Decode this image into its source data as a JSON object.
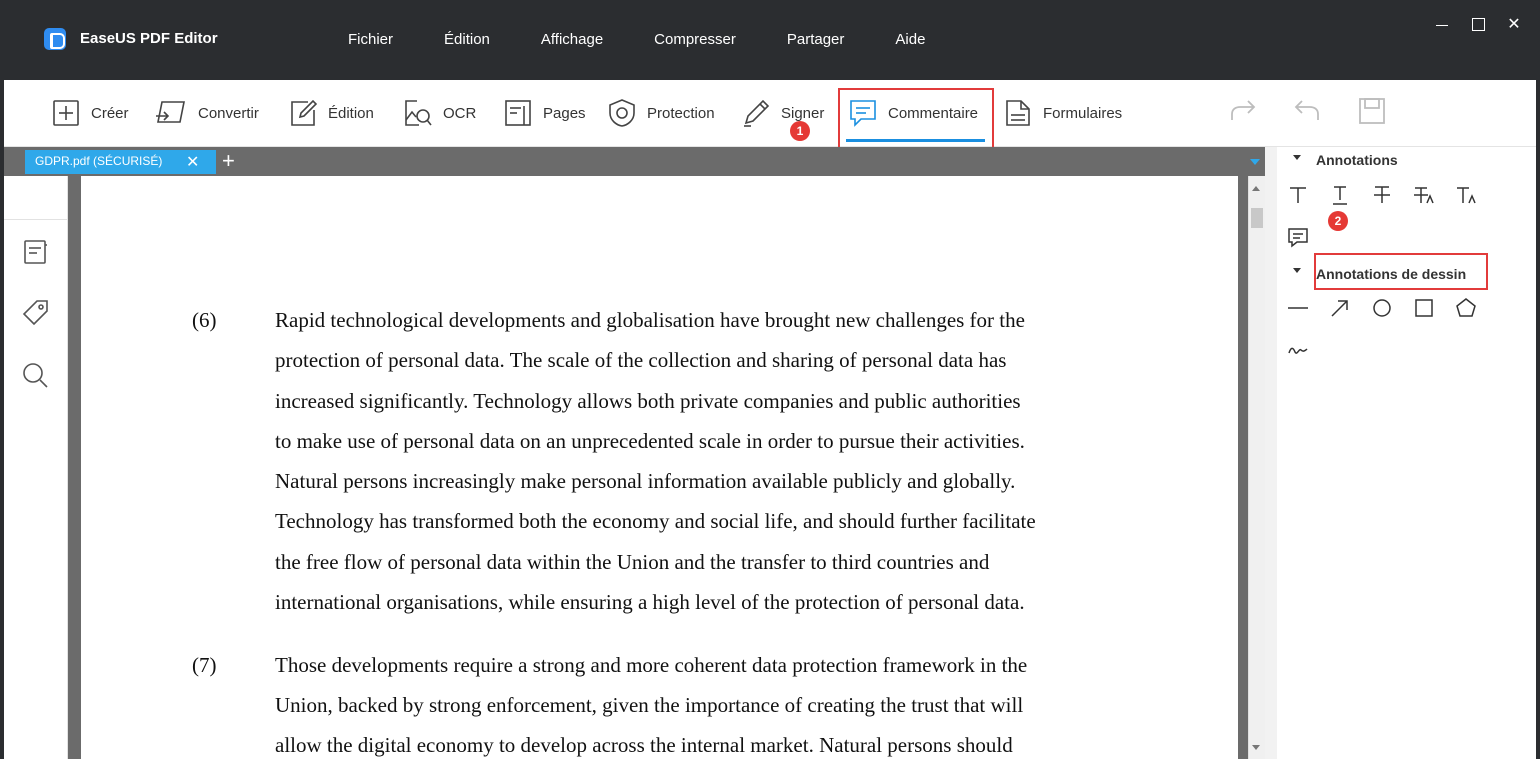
{
  "app": {
    "name": "EaseUS PDF Editor"
  },
  "menu": [
    "Fichier",
    "Édition",
    "Affichage",
    "Compresser",
    "Partager",
    "Aide"
  ],
  "toolbar": {
    "creer": "Créer",
    "convertir": "Convertir",
    "edition": "Édition",
    "ocr": "OCR",
    "pages": "Pages",
    "protection": "Protection",
    "signer": "Signer",
    "commentaire": "Commentaire",
    "formulaires": "Formulaires",
    "active_tab": "Commentaire"
  },
  "badges": {
    "one": "1",
    "two": "2"
  },
  "tabs": {
    "document": "GDPR.pdf (SÉCURISÉ)"
  },
  "right_panel": {
    "annotations": "Annotations",
    "drawing_annotations": "Annotations de dessin"
  },
  "document": {
    "p6_num": "(6)",
    "p6": [
      "Rapid technological developments and globalisation have brought new challenges for the",
      "protection of personal data. The scale of the collection and sharing of personal data has",
      "increased significantly. Technology allows both private companies and public authorities",
      "to make use of personal data on an unprecedented scale in order to pursue their activities.",
      "Natural persons increasingly make personal information available publicly and globally.",
      "Technology has transformed both the economy and social life, and should further facilitate",
      "the free flow of personal data within the Union and the transfer to third countries and",
      "international organisations, while ensuring a high level of the protection of personal data."
    ],
    "p7_num": "(7)",
    "p7": [
      "Those developments require a strong and more coherent data protection framework in the",
      "Union, backed by strong enforcement, given the importance of creating the trust that will",
      "allow the digital economy to develop across the internal market. Natural persons should"
    ]
  },
  "colors": {
    "accent": "#1a8fe0",
    "highlight": "#e23b3b",
    "titlebar": "#2b2d30",
    "tab": "#2fa8ea"
  }
}
